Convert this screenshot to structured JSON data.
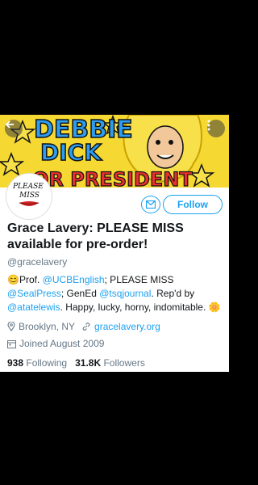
{
  "colors": {
    "accent": "#1da1f2",
    "banner_yellow": "#f6d832"
  },
  "banner": {
    "line1": "DEBBIE",
    "line2": "DICK",
    "line3": "OR PRESIDENT"
  },
  "avatar": {
    "line1": "PLEASE",
    "line2": "MISS"
  },
  "actions": {
    "follow_label": "Follow",
    "message_icon": "envelope-icon"
  },
  "profile": {
    "name": "Grace Lavery: PLEASE MISS available for pre-order!",
    "handle": "@gracelavery",
    "bio": {
      "emoji1": "😊",
      "t1": "Prof. ",
      "l1": "@UCBEnglish",
      "t2": "; PLEASE MISS ",
      "l2": "@SealPress",
      "t3": "; GenEd ",
      "l3": "@tsqjournal",
      "t4": ". Rep'd by ",
      "l4": "@atatelewis",
      "t5": ". Happy, lucky, horny, indomitable. ",
      "emoji2": "🌼"
    },
    "location": "Brooklyn, NY",
    "website": "gracelavery.org",
    "joined": "Joined August 2009",
    "following_count": "938",
    "following_label": "Following",
    "followers_count": "31.8K",
    "followers_label": "Followers"
  }
}
